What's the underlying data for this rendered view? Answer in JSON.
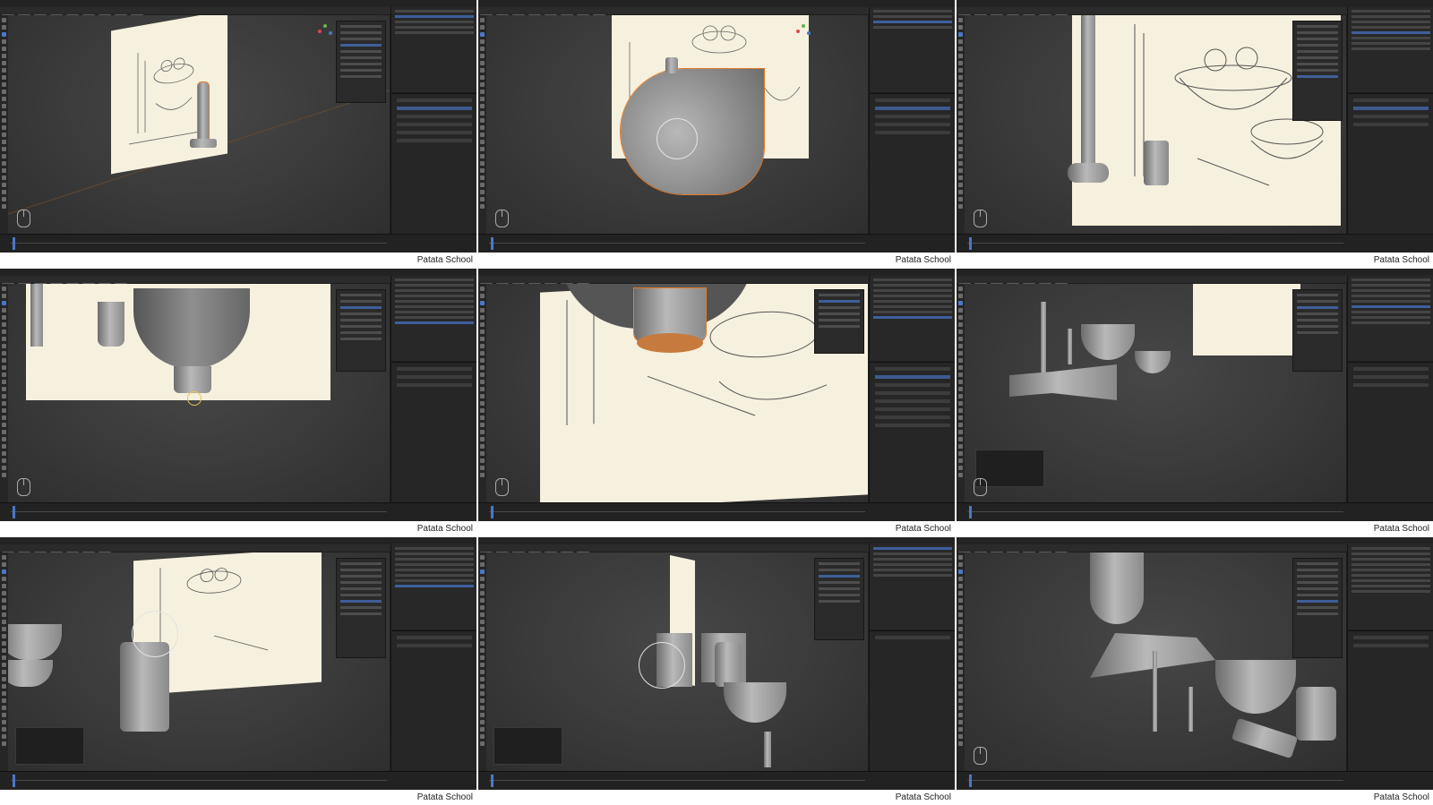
{
  "caption": "Patata School",
  "cells": [
    {
      "id": "r1c1",
      "scene": "candlestick-base"
    },
    {
      "id": "r1c2",
      "scene": "spin-profile"
    },
    {
      "id": "r1c3",
      "scene": "sketch-closeup"
    },
    {
      "id": "r2c1",
      "scene": "bowl-mesh"
    },
    {
      "id": "r2c2",
      "scene": "bowl-bottom"
    },
    {
      "id": "r2c3",
      "scene": "objects-overview"
    },
    {
      "id": "r3c1",
      "scene": "cylinder-cut"
    },
    {
      "id": "r3c2",
      "scene": "cups-side"
    },
    {
      "id": "r3c3",
      "scene": "scene-wide"
    }
  ],
  "colors": {
    "viewport": "#3a3a3a",
    "sketch_paper": "#f6f0de",
    "selection": "#e07b2a",
    "active_blue": "#4a78c8",
    "mesh_grey": "#9a9a9a"
  },
  "icons": [
    "mouse-icon",
    "navigation-gizmo-icon",
    "object-gizmo-icon"
  ]
}
